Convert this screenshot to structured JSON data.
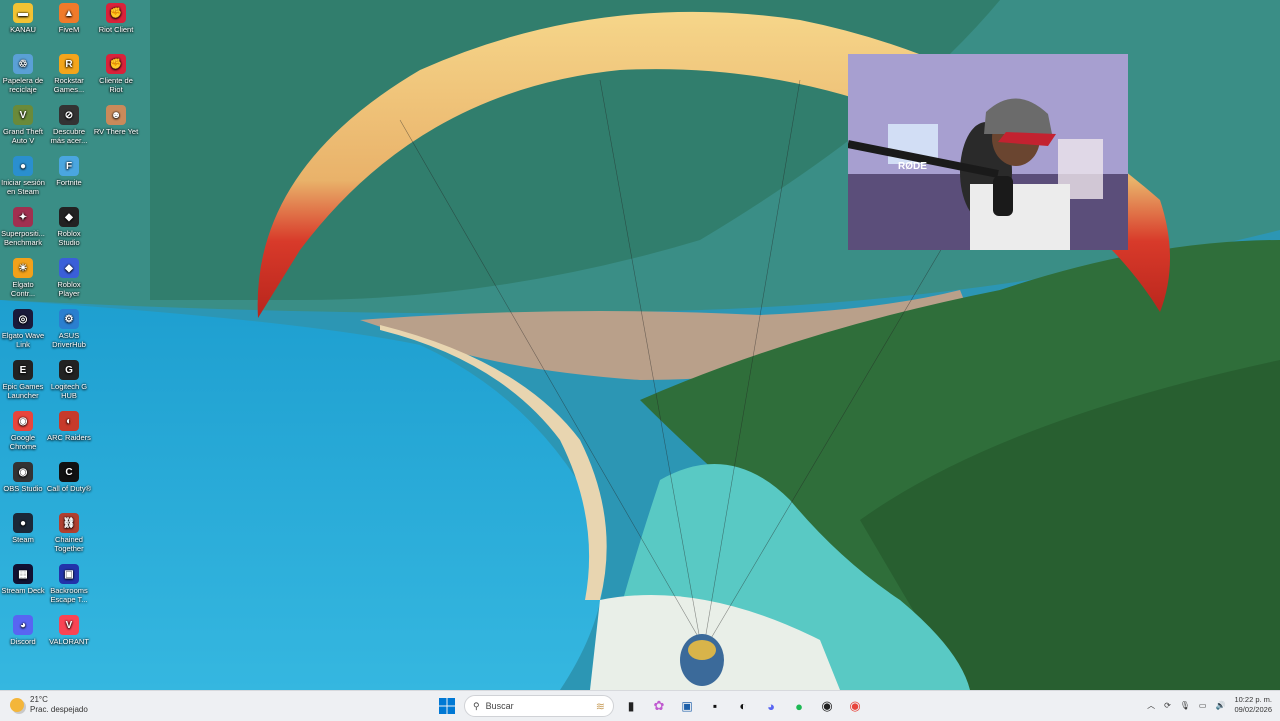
{
  "desktop_icons": [
    {
      "id": "kanau",
      "label": "KANAU",
      "glyph": "▬",
      "color": "#f2c233"
    },
    {
      "id": "fivem",
      "label": "FiveM",
      "glyph": "▲",
      "color": "#f07a2a"
    },
    {
      "id": "riot-client",
      "label": "Riot Client",
      "glyph": "✊",
      "color": "#d9223a"
    },
    {
      "id": "papelera",
      "label": "Papelera de reciclaje",
      "glyph": "♲",
      "color": "#5aa0d6"
    },
    {
      "id": "rockstar",
      "label": "Rockstar Games...",
      "glyph": "R",
      "color": "#f4a51b"
    },
    {
      "id": "cliente-riot",
      "label": "Cliente de Riot",
      "glyph": "✊",
      "color": "#d9223a"
    },
    {
      "id": "gta5",
      "label": "Grand Theft Auto V",
      "glyph": "V",
      "color": "#6a8a3a"
    },
    {
      "id": "descubre",
      "label": "Descubre más acer...",
      "glyph": "⊘",
      "color": "#333333"
    },
    {
      "id": "rv-there-yet",
      "label": "RV There Yet",
      "glyph": "☻",
      "color": "#c98a5a"
    },
    {
      "id": "steam-login",
      "label": "Iniciar sesión en Steam",
      "glyph": "●",
      "color": "#2a8fcf"
    },
    {
      "id": "fortnite",
      "label": "Fortnite",
      "glyph": "F",
      "color": "#4aa6e0"
    },
    {
      "id": "superposition",
      "label": "Superpositi... Benchmark",
      "glyph": "✦",
      "color": "#a03050"
    },
    {
      "id": "roblox-studio",
      "label": "Roblox Studio",
      "glyph": "◆",
      "color": "#222222"
    },
    {
      "id": "elgato-control",
      "label": "Elgato Contr...",
      "glyph": "☀",
      "color": "#f2a11a"
    },
    {
      "id": "roblox-player",
      "label": "Roblox Player",
      "glyph": "◆",
      "color": "#3a5fd9"
    },
    {
      "id": "elgato-wave",
      "label": "Elgato Wave Link",
      "glyph": "◎",
      "color": "#1a1a3a"
    },
    {
      "id": "asus-driverhub",
      "label": "ASUS DriverHub",
      "glyph": "⚙",
      "color": "#2a7fd0"
    },
    {
      "id": "epic-games",
      "label": "Epic Games Launcher",
      "glyph": "E",
      "color": "#222222"
    },
    {
      "id": "logitech-ghub",
      "label": "Logitech G HUB",
      "glyph": "G",
      "color": "#222222"
    },
    {
      "id": "chrome",
      "label": "Google Chrome",
      "glyph": "◉",
      "color": "#e8453c"
    },
    {
      "id": "arc-raiders",
      "label": "ARC Raiders",
      "glyph": "◐",
      "color": "#c73a2a"
    },
    {
      "id": "obs",
      "label": "OBS Studio",
      "glyph": "◉",
      "color": "#333333"
    },
    {
      "id": "call-of-duty",
      "label": "Call of Duty®",
      "glyph": "C",
      "color": "#111111"
    },
    {
      "id": "steam",
      "label": "Steam",
      "glyph": "●",
      "color": "#1b2838"
    },
    {
      "id": "chained-together",
      "label": "Chained Together",
      "glyph": "⛓",
      "color": "#b04030"
    },
    {
      "id": "stream-deck",
      "label": "Stream Deck",
      "glyph": "▦",
      "color": "#111133"
    },
    {
      "id": "backrooms",
      "label": "Backrooms Escape T...",
      "glyph": "▣",
      "color": "#2233aa"
    },
    {
      "id": "discord",
      "label": "Discord",
      "glyph": "◕",
      "color": "#5865f2"
    },
    {
      "id": "valorant",
      "label": "VALORANT",
      "glyph": "V",
      "color": "#fa4454"
    }
  ],
  "webcam": {
    "mic_brand": "RØDE"
  },
  "taskbar": {
    "weather_temp": "21°C",
    "weather_desc": "Prac. despejado",
    "search_placeholder": "Buscar",
    "clock_time": "10:22 p. m.",
    "clock_date": "09/02/2026"
  },
  "colors": {
    "taskbar_bg": "#eef0f3",
    "accent": "#0078d4"
  }
}
